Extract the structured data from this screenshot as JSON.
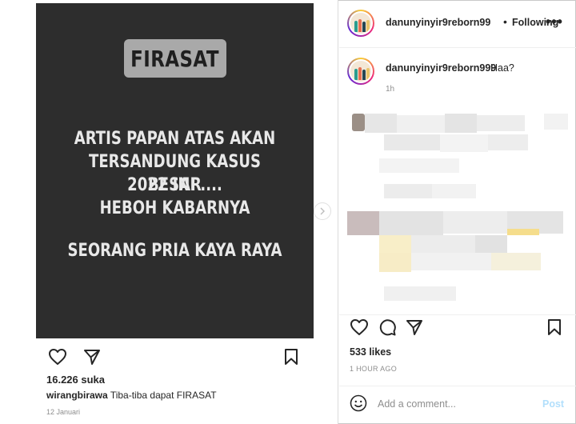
{
  "left_post": {
    "image": {
      "tag": "FIRASAT",
      "lines": [
        "ARTIS PAPAN ATAS AKAN",
        "TERSANDUNG KASUS BESAR",
        "2022 INI ....",
        "HEBOH KABARNYA",
        "SEORANG PRIA KAYA RAYA"
      ],
      "background": "#2d2d2d"
    },
    "likes": "16.226 suka",
    "caption_user": "wirangbirawa",
    "caption_text": "Tiba-tiba dapat FIRASAT",
    "date": "12 Januari",
    "icons": [
      "heart-icon",
      "share-icon",
      "bookmark-icon",
      "chevron-right-icon"
    ]
  },
  "right_panel": {
    "header": {
      "username": "danunyinyir9reborn99",
      "separator": "•",
      "follow_label": "Following",
      "more_label": "•••"
    },
    "caption": {
      "username": "danunyinyir9reborn999",
      "text": "Haa?",
      "time": "1h"
    },
    "likes": "533 likes",
    "timestamp": "1 HOUR AGO",
    "comment_placeholder": "Add a comment...",
    "post_label": "Post",
    "icons": [
      "heart-icon",
      "comment-icon",
      "share-icon",
      "bookmark-icon",
      "emoji-icon"
    ],
    "colors": {
      "post_disabled": "#b2dffc",
      "muted": "#8e8e8e",
      "text": "#262626"
    }
  }
}
